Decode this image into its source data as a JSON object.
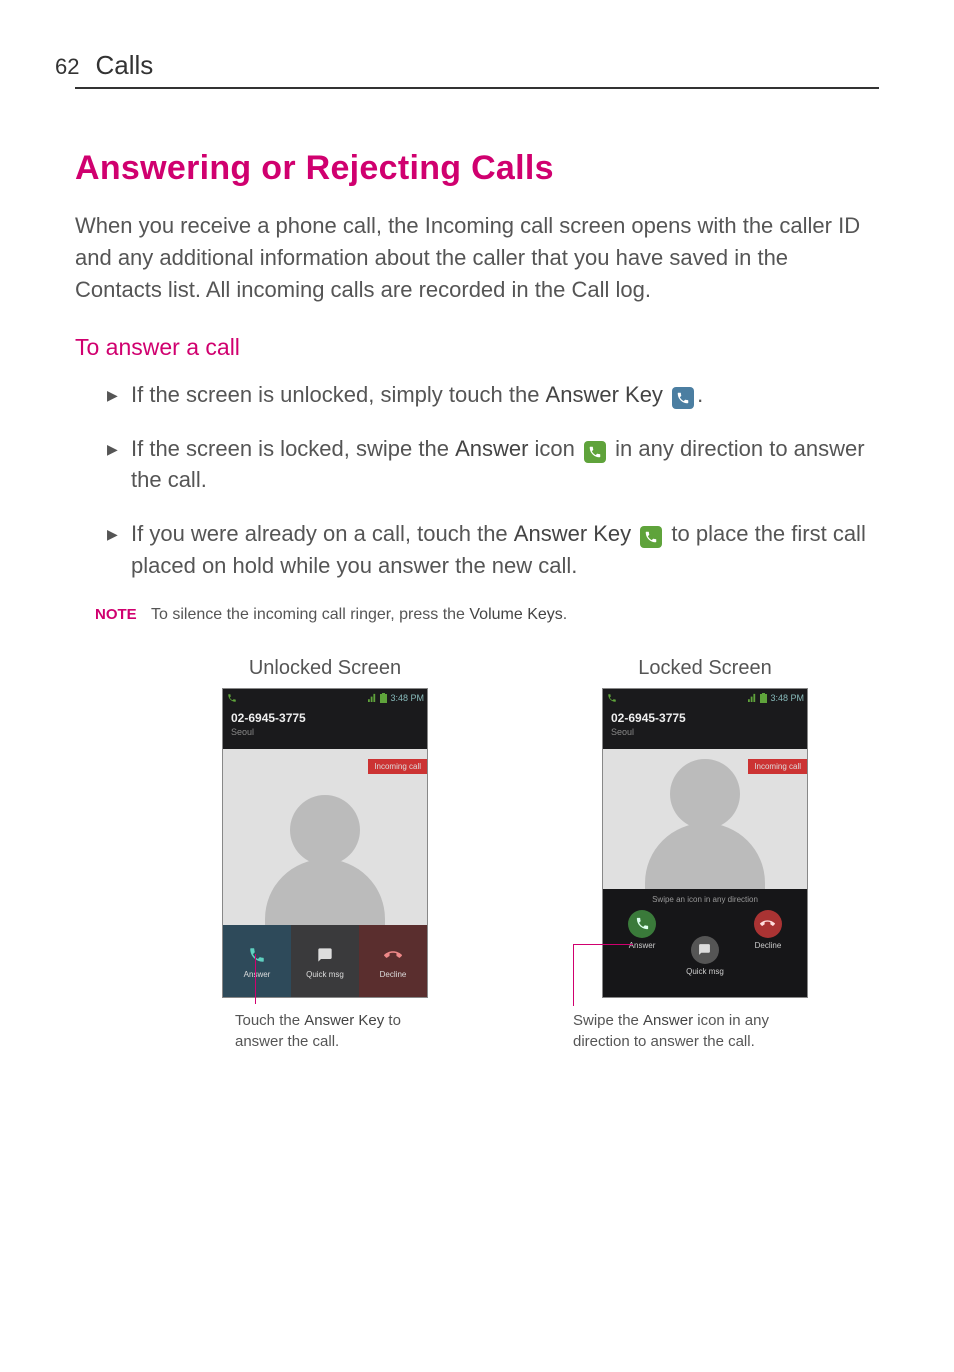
{
  "header": {
    "page_number": "62",
    "section": "Calls"
  },
  "heading": "Answering or Rejecting Calls",
  "intro": "When you receive a phone call, the Incoming call screen opens with the caller ID and any additional information about the caller that you have saved in the Contacts list. All incoming calls are recorded in the Call log.",
  "subheading": "To answer a call",
  "bullets": {
    "b1": {
      "pre": "If the screen is unlocked, simply touch the ",
      "key": "Answer Key",
      "post": "."
    },
    "b2": {
      "pre": "If the screen is locked, swipe the ",
      "key": "Answer",
      "mid": " icon ",
      "post": " in any direction to answer the call."
    },
    "b3": {
      "pre": "If you were already on a call, touch the ",
      "key": "Answer Key",
      "post": " to place the first call placed on hold while you answer the new call."
    }
  },
  "note": {
    "label": "NOTE",
    "pre": "To silence the incoming call ringer, press the ",
    "key": "Volume Keys",
    "post": "."
  },
  "screens": {
    "unlocked": {
      "title": "Unlocked Screen",
      "status_time": "3:48 PM",
      "caller_number": "02-6945-3775",
      "caller_location": "Seoul",
      "incoming_label": "Incoming call",
      "btn_answer": "Answer",
      "btn_quick": "Quick msg",
      "btn_decline": "Decline",
      "callout_pre": "Touch the ",
      "callout_key": "Answer Key",
      "callout_post": " to answer the call."
    },
    "locked": {
      "title": "Locked Screen",
      "status_time": "3:48 PM",
      "caller_number": "02-6945-3775",
      "caller_location": "Seoul",
      "incoming_label": "Incoming call",
      "swipe_hint": "Swipe an icon in any direction",
      "btn_answer": "Answer",
      "btn_quick": "Quick msg",
      "btn_decline": "Decline",
      "callout_pre": "Swipe the ",
      "callout_key": "Answer",
      "callout_post": " icon in any direction to answer the call."
    }
  }
}
